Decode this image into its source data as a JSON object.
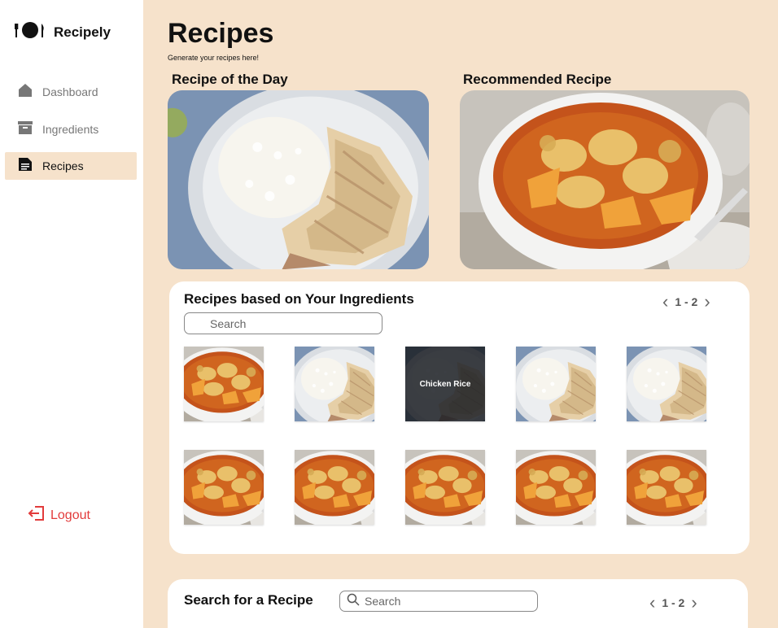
{
  "app": {
    "name": "Recipely",
    "logo_icon": "plate-cutlery-icon"
  },
  "sidebar": {
    "items": [
      {
        "label": "Dashboard",
        "icon": "home-icon",
        "active": false
      },
      {
        "label": "Ingredients",
        "icon": "archive-box-icon",
        "active": false
      },
      {
        "label": "Recipes",
        "icon": "document-icon",
        "active": true
      }
    ],
    "logout_label": "Logout",
    "logout_icon": "logout-icon",
    "logout_color": "#e23b3b"
  },
  "header": {
    "title": "Recipes",
    "subtitle": "Generate your recipes here!"
  },
  "featured": {
    "day_title": "Recipe of the Day",
    "day_image": "chicken-rice-photo",
    "recommended_title": "Recommended Recipe",
    "recommended_image": "chicken-curry-photo"
  },
  "ingredients_section": {
    "title": "Recipes based on Your Ingredients",
    "search_placeholder": "Search",
    "pager": "1 - 2",
    "tiles": [
      {
        "image": "chicken-curry-photo",
        "caption": ""
      },
      {
        "image": "chicken-rice-photo",
        "caption": ""
      },
      {
        "image": "chicken-rice-photo",
        "caption": "Chicken Rice"
      },
      {
        "image": "chicken-rice-photo",
        "caption": ""
      },
      {
        "image": "chicken-rice-photo",
        "caption": ""
      },
      {
        "image": "chicken-curry-photo",
        "caption": ""
      },
      {
        "image": "chicken-curry-photo",
        "caption": ""
      },
      {
        "image": "chicken-curry-photo",
        "caption": ""
      },
      {
        "image": "chicken-curry-photo",
        "caption": ""
      },
      {
        "image": "chicken-curry-photo",
        "caption": ""
      }
    ]
  },
  "search_section": {
    "title": "Search for a Recipe",
    "search_placeholder": "Search",
    "pager": "1 - 2"
  },
  "colors": {
    "accent_bg": "#f6e2cb",
    "sidebar_bg": "#ffffff",
    "logout": "#e23b3b"
  }
}
